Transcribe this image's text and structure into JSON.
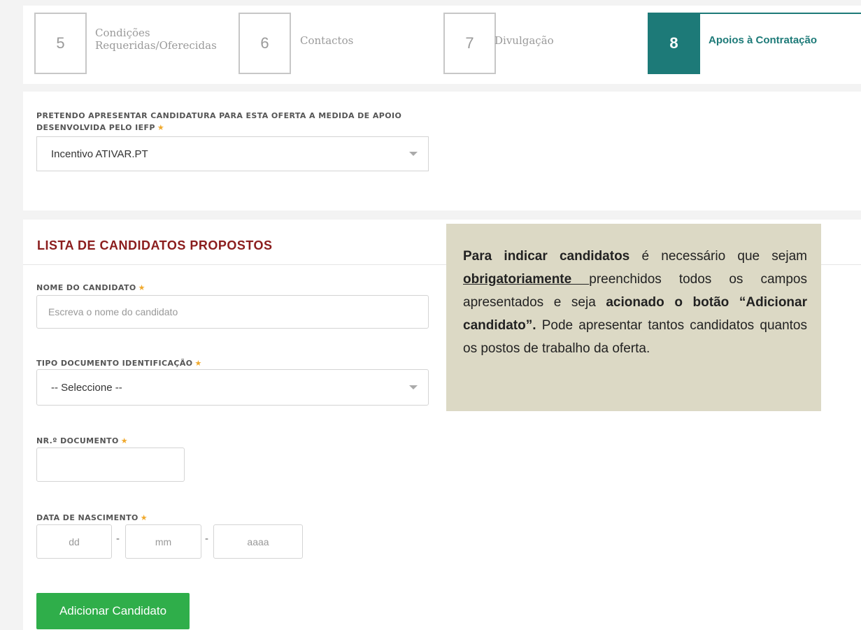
{
  "steps": [
    {
      "num": "5",
      "label": "Condições Requeridas/Oferecidas",
      "active": false
    },
    {
      "num": "6",
      "label": "Contactos",
      "active": false
    },
    {
      "num": "7",
      "label": "Divulgação",
      "active": false
    },
    {
      "num": "8",
      "label": "Apoios à Contratação",
      "active": true
    }
  ],
  "apoio": {
    "label": "PRETENDO APRESENTAR CANDIDATURA PARA ESTA OFERTA A MEDIDA DE APOIO DESENVOLVIDA PELO IEFP",
    "selected": "Incentivo ATIVAR.PT"
  },
  "candidatos": {
    "title": "LISTA DE CANDIDATOS PROPOSTOS",
    "nome_label": "NOME DO CANDIDATO",
    "nome_placeholder": "Escreva o nome do candidato",
    "tipo_label": "TIPO DOCUMENTO IDENTIFICAÇÃO",
    "tipo_selected": "-- Seleccione --",
    "nr_label": "NR.º DOCUMENTO",
    "data_label": "DATA DE NASCIMENTO",
    "dd_placeholder": "dd",
    "mm_placeholder": "mm",
    "aaaa_placeholder": "aaaa",
    "separator": "-",
    "add_button": "Adicionar Candidato",
    "required_mark": "★"
  },
  "note": {
    "p1_bold": "Para indicar candidatos",
    "p1_text": " é necessário que sejam ",
    "p1_underline": "obrigatoriamente ",
    "p1_text2": "preenchidos todos os campos apresentados e seja ",
    "p1_bold2": "acionado o botão “Adicionar candidato”.",
    "p1_text3": " Pode apresentar tantos candidatos quantos os postos de trabalho da oferta."
  },
  "colors": {
    "accent": "#1d7a78",
    "title_red": "#8b1d1d",
    "button_green": "#2fae4a",
    "note_bg": "#dcd9c5",
    "star": "#f0a92c"
  }
}
